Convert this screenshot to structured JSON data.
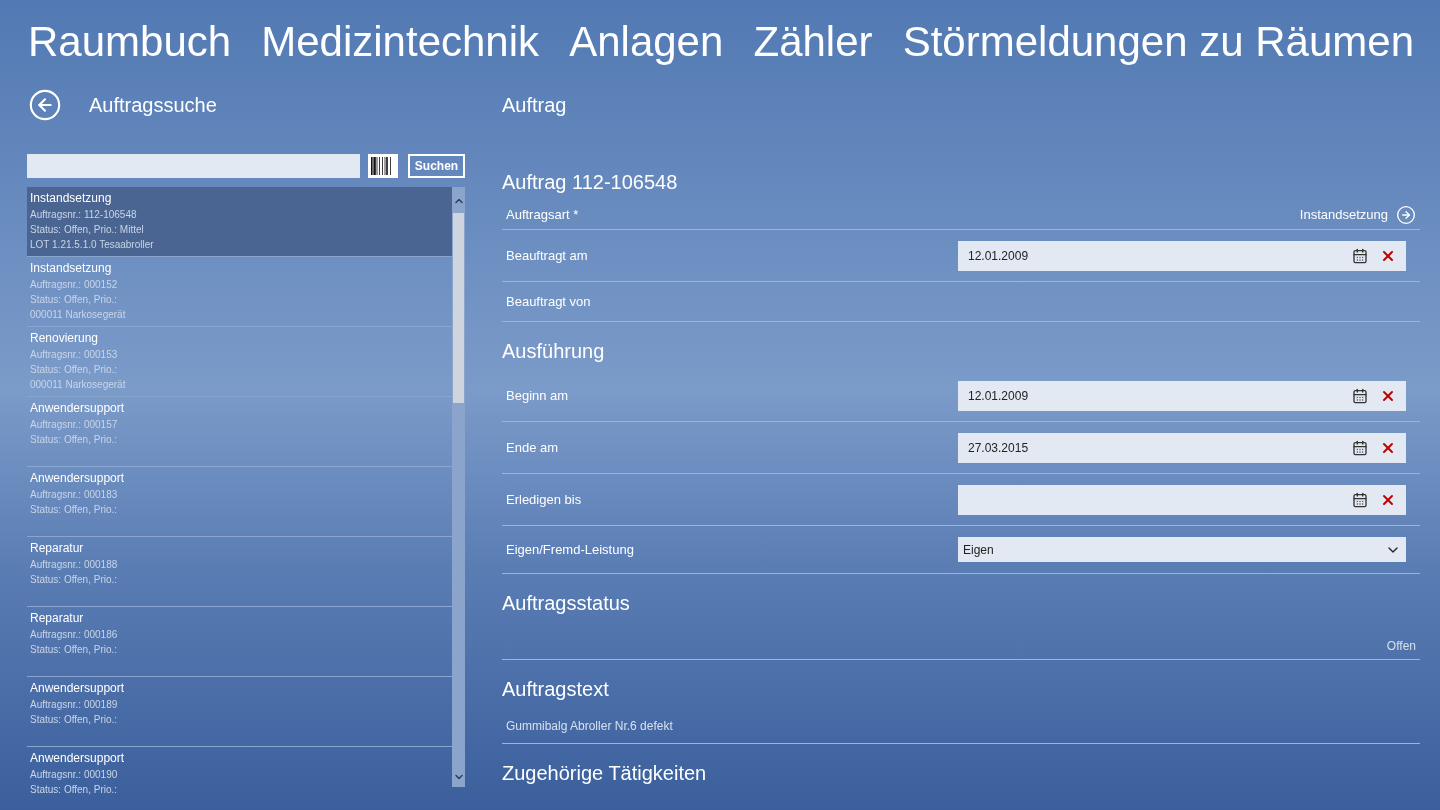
{
  "nav": [
    {
      "label": "Raumbuch"
    },
    {
      "label": "Medizintechnik"
    },
    {
      "label": "Anlagen"
    },
    {
      "label": "Zähler"
    },
    {
      "label": "Störmeldungen zu Räumen"
    }
  ],
  "search_page": {
    "title": "Auftragssuche",
    "button": "Suchen"
  },
  "list": [
    {
      "title": "Instandsetzung",
      "lines": [
        "Auftragsnr.: 112-106548",
        "Status: Offen, Prio.: Mittel",
        "LOT 1.21.5.1.0 Tesaabroller"
      ],
      "selected": true
    },
    {
      "title": "Instandsetzung",
      "lines": [
        "Auftragsnr.: 000152",
        "Status: Offen, Prio.:",
        "000011 Narkosegerät"
      ],
      "selected": false
    },
    {
      "title": "Renovierung",
      "lines": [
        "Auftragsnr.: 000153",
        "Status: Offen, Prio.:",
        "000011 Narkosegerät"
      ],
      "selected": false
    },
    {
      "title": "Anwendersupport",
      "lines": [
        "Auftragsnr.: 000157",
        "Status: Offen, Prio.:"
      ],
      "selected": false
    },
    {
      "title": "Anwendersupport",
      "lines": [
        "Auftragsnr.: 000183",
        "Status: Offen, Prio.:"
      ],
      "selected": false
    },
    {
      "title": "Reparatur",
      "lines": [
        "Auftragsnr.: 000188",
        "Status: Offen, Prio.:"
      ],
      "selected": false
    },
    {
      "title": "Reparatur",
      "lines": [
        "Auftragsnr.: 000186",
        "Status: Offen, Prio.:"
      ],
      "selected": false
    },
    {
      "title": "Anwendersupport",
      "lines": [
        "Auftragsnr.: 000189",
        "Status: Offen, Prio.:"
      ],
      "selected": false
    },
    {
      "title": "Anwendersupport",
      "lines": [
        "Auftragsnr.: 000190",
        "Status: Offen, Prio.:"
      ],
      "selected": false
    }
  ],
  "detail": {
    "title": "Auftrag",
    "sections": [
      {
        "heading": "Auftrag 112-106548",
        "rows": [
          {
            "kind": "link",
            "label": "Auftragsart *",
            "value": "Instandsetzung"
          },
          {
            "kind": "date",
            "label": "Beauftragt am",
            "value": "12.01.2009"
          },
          {
            "kind": "text",
            "label": "Beauftragt von"
          }
        ]
      },
      {
        "heading": "Ausführung",
        "rows": [
          {
            "kind": "date",
            "label": "Beginn am",
            "value": "12.01.2009"
          },
          {
            "kind": "date",
            "label": "Ende am",
            "value": "27.03.2015"
          },
          {
            "kind": "date",
            "label": "Erledigen bis"
          },
          {
            "kind": "select",
            "label": "Eigen/Fremd-Leistung",
            "value": "Eigen"
          }
        ]
      },
      {
        "heading": "Auftragsstatus",
        "rows": [
          {
            "kind": "value",
            "value": "Offen"
          }
        ]
      },
      {
        "heading": "Auftragstext",
        "rows": [
          {
            "kind": "note",
            "value": "Gummibalg Abroller Nr.6 defekt"
          }
        ]
      },
      {
        "heading": "Zugehörige Tätigkeiten"
      }
    ]
  }
}
